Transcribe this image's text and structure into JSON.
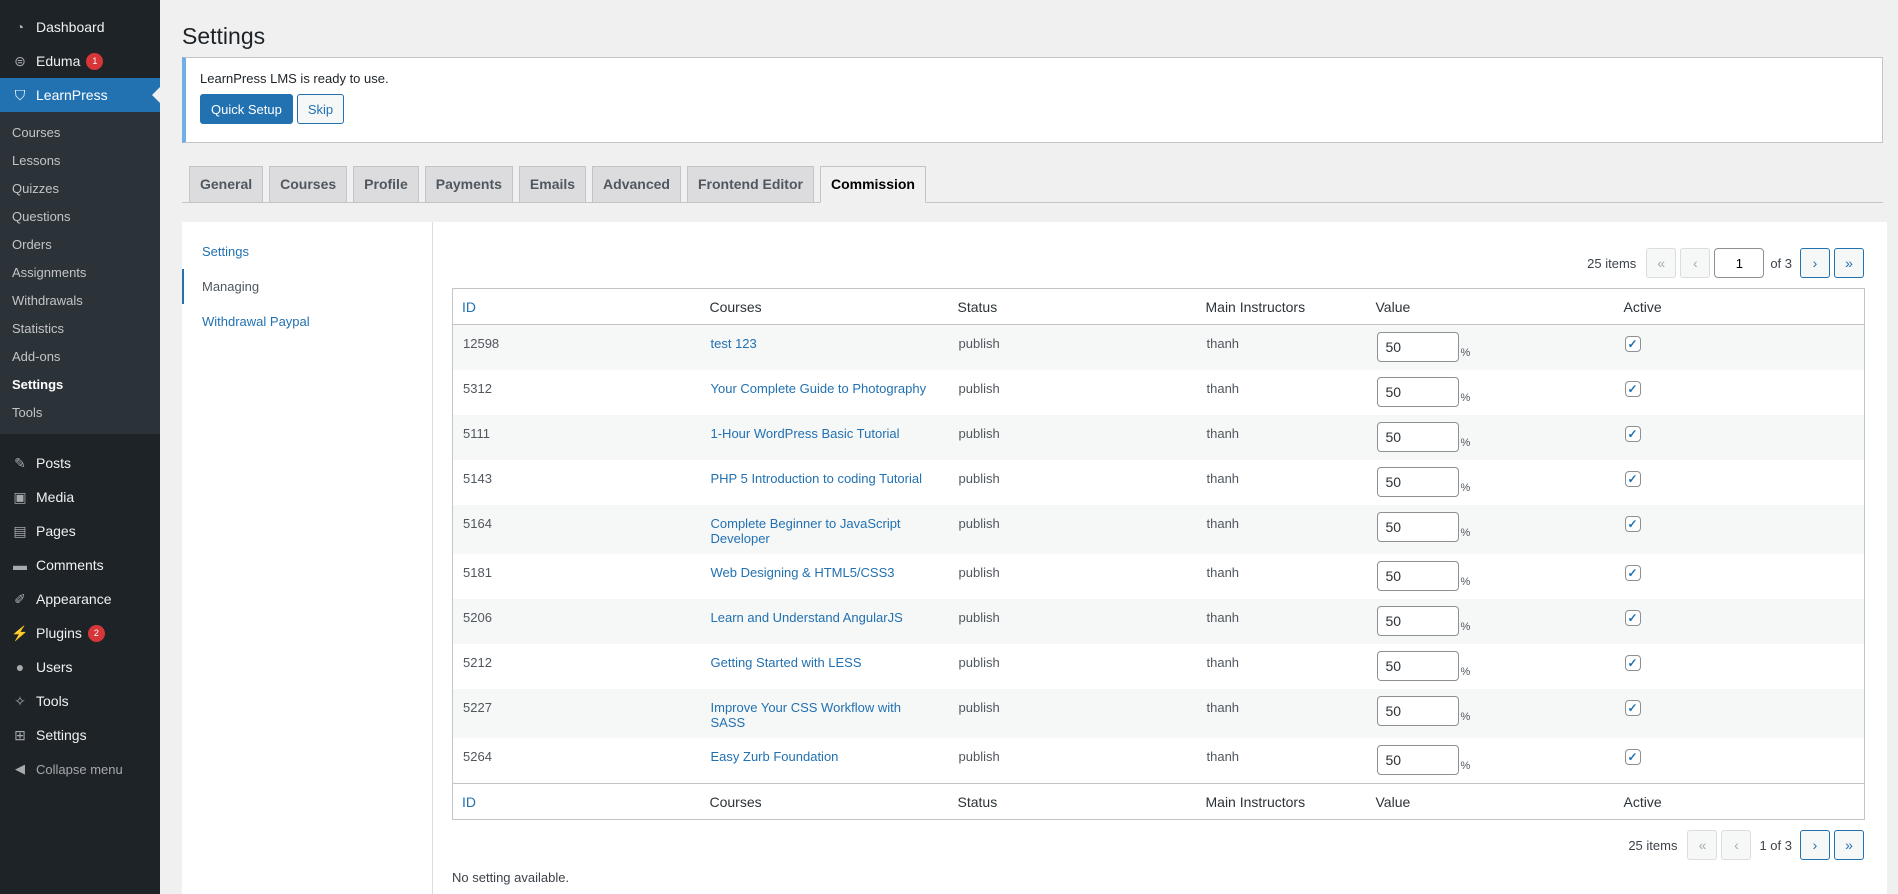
{
  "sidebar": {
    "top": [
      {
        "label": "Dashboard",
        "icon": "dashboard-icon",
        "glyph": "◔"
      },
      {
        "label": "Eduma",
        "icon": "eduma-logo-icon",
        "glyph": "⊜",
        "badge": "1"
      },
      {
        "label": "LearnPress",
        "icon": "graduation-cap-icon",
        "glyph": "⛉"
      }
    ],
    "submenu": [
      "Courses",
      "Lessons",
      "Quizzes",
      "Questions",
      "Orders",
      "Assignments",
      "Withdrawals",
      "Statistics",
      "Add-ons",
      "Settings",
      "Tools"
    ],
    "group2": [
      {
        "label": "Posts",
        "icon": "pushpin-icon",
        "glyph": "✎"
      },
      {
        "label": "Media",
        "icon": "media-icon",
        "glyph": "▣"
      },
      {
        "label": "Pages",
        "icon": "pages-icon",
        "glyph": "▤"
      },
      {
        "label": "Comments",
        "icon": "comment-icon",
        "glyph": "▬"
      }
    ],
    "group3": [
      {
        "label": "Appearance",
        "icon": "paintbrush-icon",
        "glyph": "✐"
      },
      {
        "label": "Plugins",
        "icon": "plugin-icon",
        "glyph": "⚡",
        "badge": "2"
      },
      {
        "label": "Users",
        "icon": "user-icon",
        "glyph": "●"
      },
      {
        "label": "Tools",
        "icon": "wrench-icon",
        "glyph": "✧"
      },
      {
        "label": "Settings",
        "icon": "settings-icon",
        "glyph": "⊞"
      },
      {
        "label": "Collapse menu",
        "icon": "collapse-icon",
        "glyph": "◀"
      }
    ]
  },
  "page": {
    "title": "Settings"
  },
  "notice": {
    "message": "LearnPress LMS is ready to use.",
    "quick_setup": "Quick Setup",
    "skip": "Skip"
  },
  "tabs": [
    "General",
    "Courses",
    "Profile",
    "Payments",
    "Emails",
    "Advanced",
    "Frontend Editor",
    "Commission"
  ],
  "subnav": [
    "Settings",
    "Managing",
    "Withdrawal Paypal"
  ],
  "pagination": {
    "items": "25 items",
    "first": "«",
    "prev": "‹",
    "next": "›",
    "last": "»",
    "current_page": "1",
    "of_total": "of 3",
    "bottom_status": "1 of 3"
  },
  "table": {
    "headers": [
      "ID",
      "Courses",
      "Status",
      "Main Instructors",
      "Value",
      "Active"
    ],
    "rows": [
      {
        "id": "12598",
        "course": "test 123",
        "status": "publish",
        "instructor": "thanh",
        "value": "50",
        "unit": "%",
        "active": true
      },
      {
        "id": "5312",
        "course": "Your Complete Guide to Photography",
        "status": "publish",
        "instructor": "thanh",
        "value": "50",
        "unit": "%",
        "active": true
      },
      {
        "id": "5111",
        "course": "1-Hour WordPress Basic Tutorial",
        "status": "publish",
        "instructor": "thanh",
        "value": "50",
        "unit": "%",
        "active": true
      },
      {
        "id": "5143",
        "course": "PHP 5 Introduction to coding Tutorial",
        "status": "publish",
        "instructor": "thanh",
        "value": "50",
        "unit": "%",
        "active": true
      },
      {
        "id": "5164",
        "course": "Complete Beginner to JavaScript Developer",
        "status": "publish",
        "instructor": "thanh",
        "value": "50",
        "unit": "%",
        "active": true
      },
      {
        "id": "5181",
        "course": "Web Designing & HTML5/CSS3",
        "status": "publish",
        "instructor": "thanh",
        "value": "50",
        "unit": "%",
        "active": true
      },
      {
        "id": "5206",
        "course": "Learn and Understand AngularJS",
        "status": "publish",
        "instructor": "thanh",
        "value": "50",
        "unit": "%",
        "active": true
      },
      {
        "id": "5212",
        "course": "Getting Started with LESS",
        "status": "publish",
        "instructor": "thanh",
        "value": "50",
        "unit": "%",
        "active": true
      },
      {
        "id": "5227",
        "course": "Improve Your CSS Workflow with SASS",
        "status": "publish",
        "instructor": "thanh",
        "value": "50",
        "unit": "%",
        "active": true
      },
      {
        "id": "5264",
        "course": "Easy Zurb Foundation",
        "status": "publish",
        "instructor": "thanh",
        "value": "50",
        "unit": "%",
        "active": true
      }
    ]
  },
  "footer_note": "No setting available.",
  "colors": {
    "accent": "#2271b1",
    "sidebar_bg": "#1d2327",
    "badge": "#d63638"
  }
}
